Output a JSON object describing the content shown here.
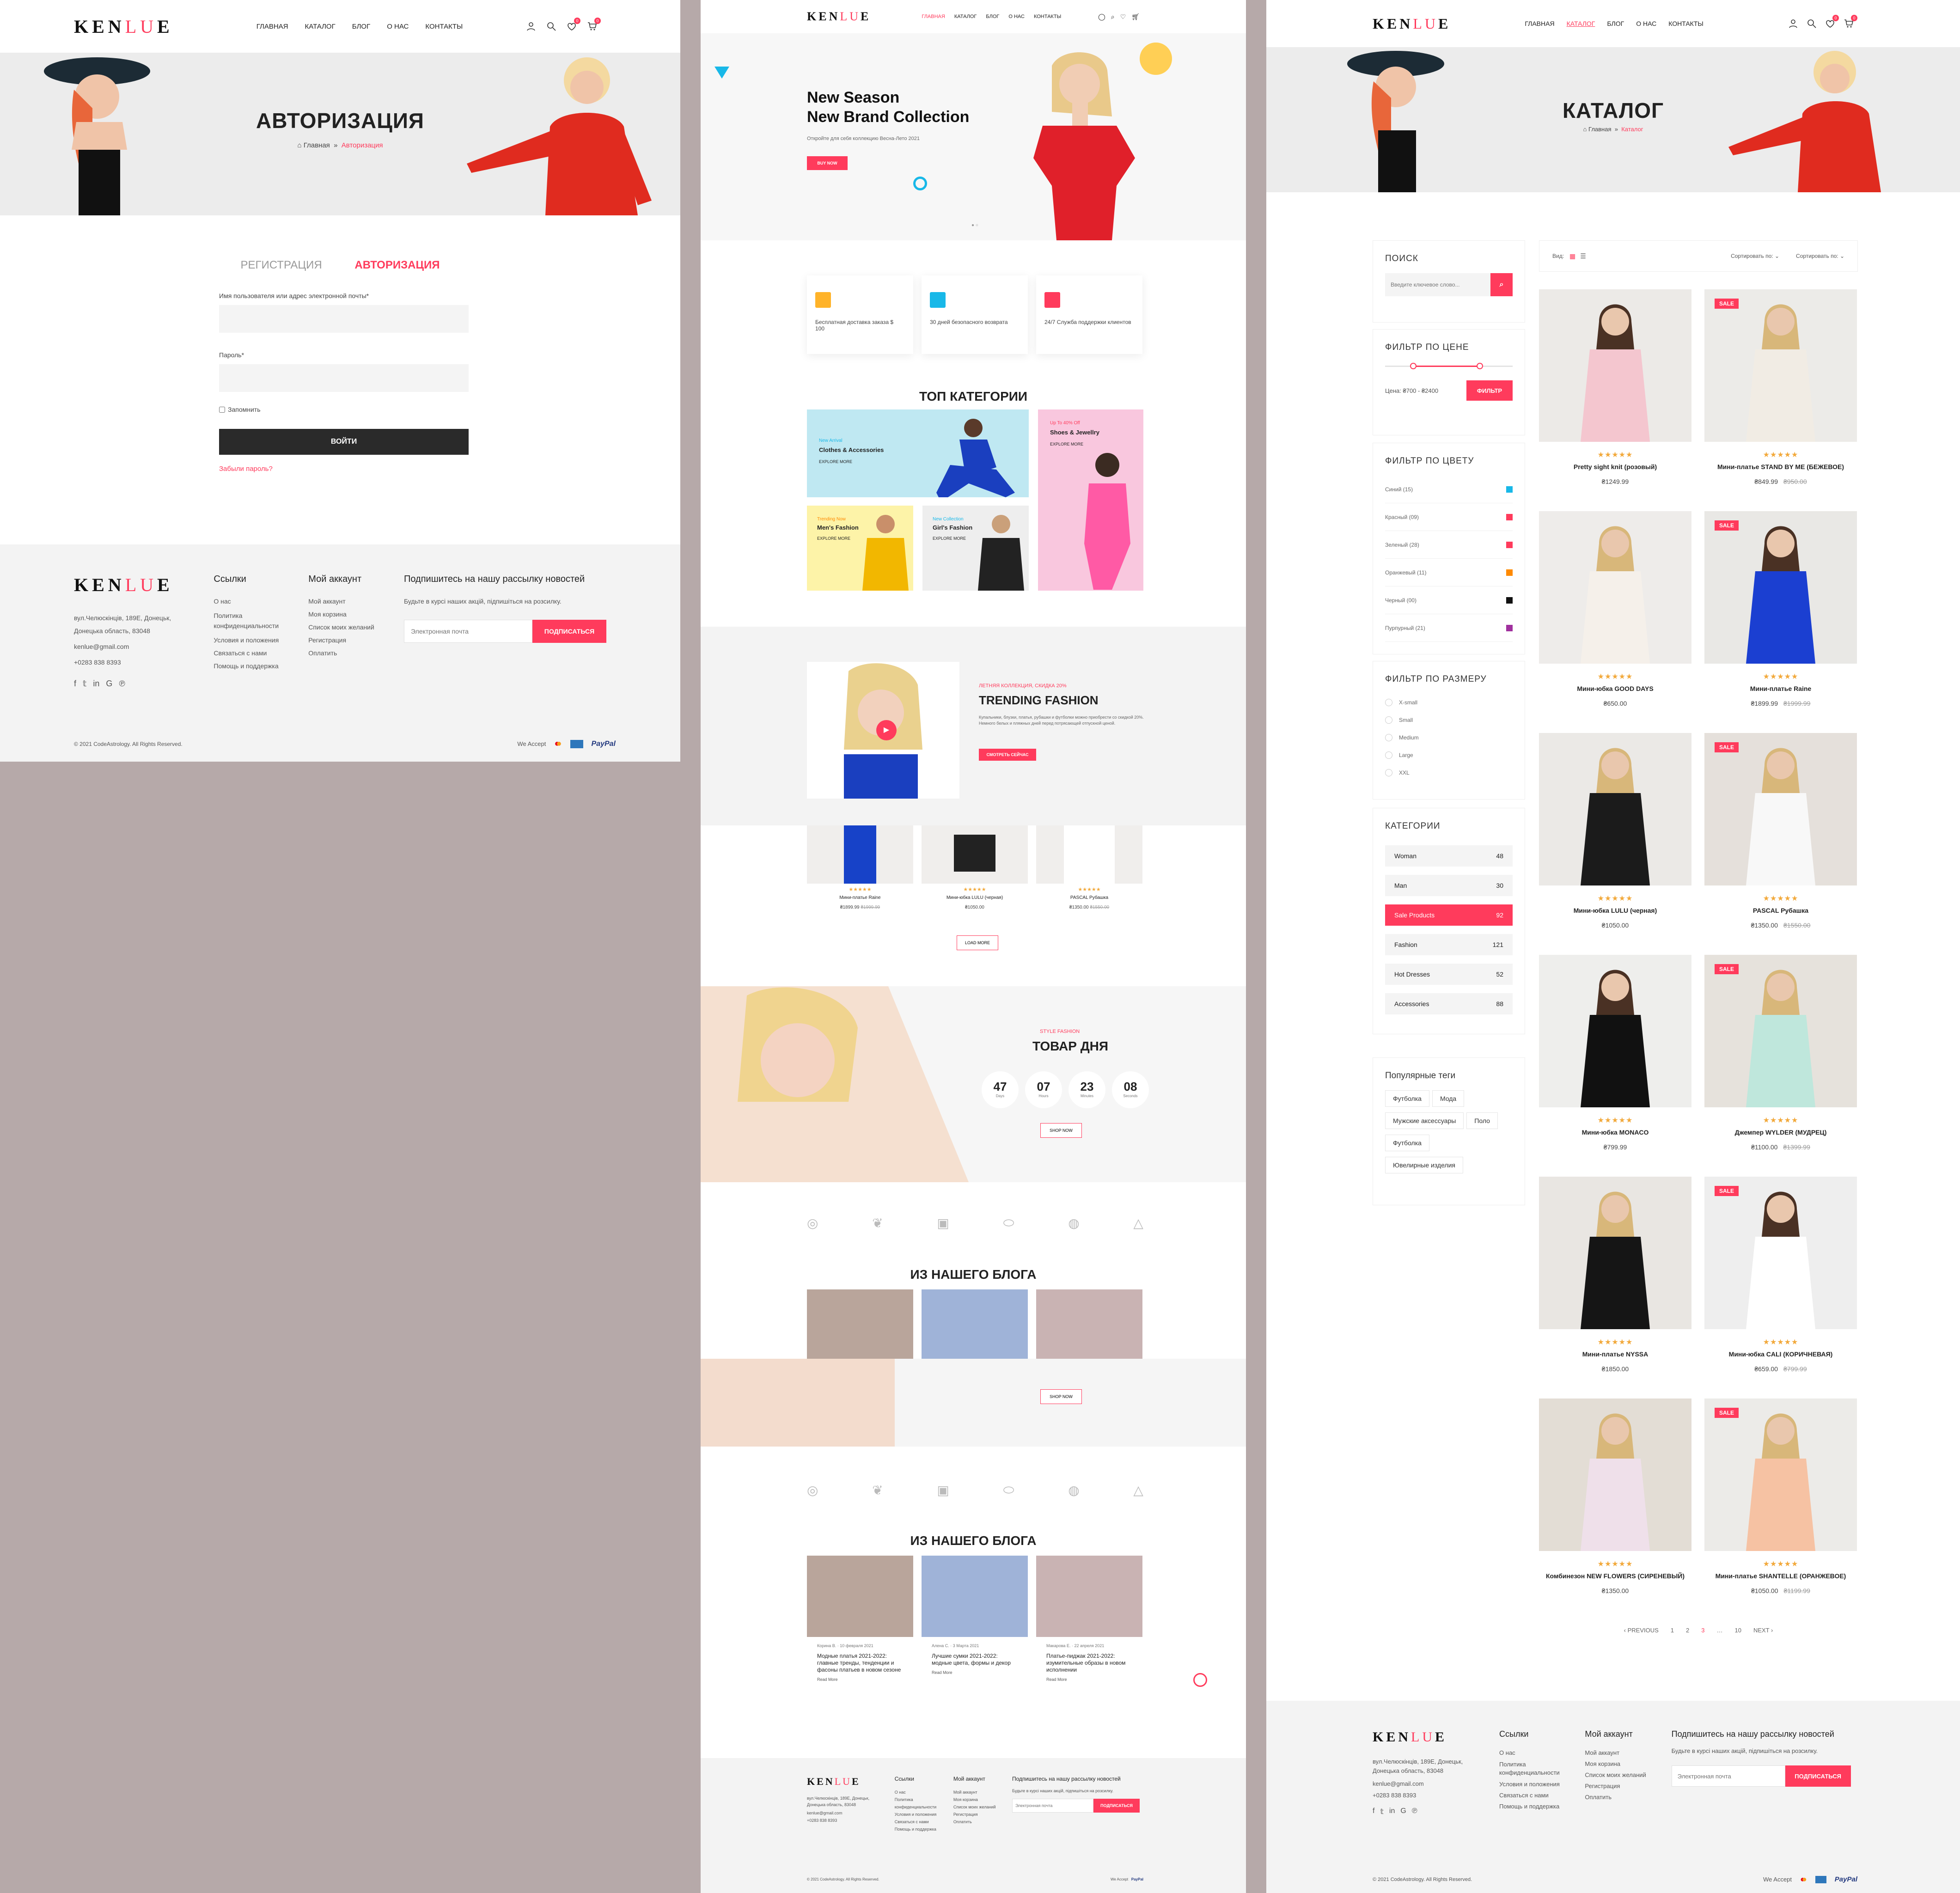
{
  "brand": {
    "logo_a": "KEN",
    "logo_b": "LU",
    "logo_c": "E"
  },
  "nav": {
    "home": "ГЛАВНАЯ",
    "catalog": "КАТАЛОГ",
    "blog": "БЛОГ",
    "about": "О НАС",
    "contacts": "КОНТАКТЫ"
  },
  "icons": {
    "user": "user-icon",
    "search": "search-icon",
    "wishlist": "heart-icon",
    "cart": "cart-icon"
  },
  "header_badges": {
    "wishlist": "0",
    "cart": "0"
  },
  "colors": {
    "accent": "#ff3b5c",
    "dark": "#222222",
    "stars": "#f2a93b"
  },
  "login_page": {
    "banner_title": "АВТОРИЗАЦИЯ",
    "crumb_home": "Главная",
    "crumb_current": "Авторизация",
    "tab_register": "РЕГИСТРАЦИЯ",
    "tab_login": "АВТОРИЗАЦИЯ",
    "username_label": "Имя пользователя или адрес электронной почты*",
    "password_label": "Пароль*",
    "remember_label": "Запомнить",
    "login_button": "ВОЙТИ",
    "forgot_link": "Забыли пароль?"
  },
  "footer": {
    "address": "вул.Челюскінців, 189Е, Донецьк, Донецька область, 83048",
    "email": "kenlue@gmail.com",
    "phone": "+0283 838 8393",
    "links_title": "Ссылки",
    "links": [
      "О нас",
      "Политика конфиденциальности",
      "Условия и положения",
      "Связаться с нами",
      "Помощь и поддержка"
    ],
    "account_title": "Мой аккаунт",
    "account_links": [
      "Мой аккаунт",
      "Моя корзина",
      "Список моих желаний",
      "Регистрация",
      "Оплатить"
    ],
    "newsletter_title": "Подпишитесь на нашу рассылку новостей",
    "newsletter_text": "Будьте в курсі наших акцій, підпишіться на розсилку.",
    "email_placeholder": "Электронная почта",
    "subscribe_button": "ПОДПИСАТЬСЯ",
    "copyright": "© 2021 CodeAstrology. All Rights Reserved.",
    "we_accept": "We Accept",
    "paypal": "PayPal"
  },
  "home_page": {
    "hero_line1": "New Season",
    "hero_line2": "New Brand Collection",
    "hero_sub": "Откройте для себя коллекцию Весна-Лето 2021",
    "hero_button": "BUY NOW",
    "features": [
      "Бесплатная доставка заказа $ 100",
      "30 дней безопасного возврата",
      "24/7 Служба поддержки клиентов"
    ],
    "top_categories_title": "ТОП КАТЕГОРИИ",
    "cat1_kicker": "New Arrival",
    "cat1_title": "Clothes & Accessories",
    "cat1_link": "EXPLORE MORE",
    "cat2_kicker": "Up To 40% Off",
    "cat2_title": "Shoes & Jewellry",
    "cat2_link": "EXPLORE MORE",
    "cat3_kicker": "Trending Now",
    "cat3_title": "Men's Fashion",
    "cat3_link": "EXPLORE MORE",
    "cat4_kicker": "New Collection",
    "cat4_title": "Girl's Fashion",
    "cat4_link": "EXPLORE MORE",
    "trend_kicker": "ЛЕТНЯЯ КОЛЛЕКЦИЯ, СКИДКА 20%",
    "trend_title": "TRENDING FASHION",
    "trend_text": "Купальники, блузки, платья, рубашки и футболки можно приобрести со скидкой 20%. Немного белых и пляжных дней перед потрясающей отпускной ценой.",
    "trend_button": "СМОТРЕТЬ СЕЙЧАС",
    "mini_products": [
      {
        "name": "Мини-платье Raine",
        "price": "₴1899.99",
        "old": "₴1999.99"
      },
      {
        "name": "Мини-юбка LULU (черная)",
        "price": "₴1050.00",
        "old": ""
      },
      {
        "name": "PASCAL Рубашка",
        "price": "₴1350.00",
        "old": "₴1550.00"
      }
    ],
    "load_more": "LOAD MORE",
    "deal_kicker": "STYLE FASHION",
    "deal_title": "ТОВАР ДНЯ",
    "countdown": [
      {
        "v": "47",
        "l": "Days"
      },
      {
        "v": "07",
        "l": "Hours"
      },
      {
        "v": "23",
        "l": "Minutes"
      },
      {
        "v": "08",
        "l": "Seconds"
      }
    ],
    "deal_button": "SHOP NOW",
    "blog_title": "ИЗ НАШЕГО БЛОГА",
    "posts": [
      {
        "author": "Корина В.",
        "date": "10 февраля 2021",
        "title": "Модные платья 2021-2022: главные тренды, тенденции и фасоны платьев в новом сезоне",
        "more": "Read More"
      },
      {
        "author": "Алена С.",
        "date": "3 Марта 2021",
        "title": "Лучшие сумки 2021-2022: модные цвета, формы и декор",
        "more": "Read More"
      },
      {
        "author": "Макарова Е.",
        "date": "22 апреля 2021",
        "title": "Платье-пиджак 2021-2022: изумительные образы в новом исполнении",
        "more": "Read More"
      }
    ]
  },
  "catalog_page": {
    "banner_title": "КАТАЛОГ",
    "crumb_home": "Главная",
    "crumb_current": "Каталог",
    "search_title": "ПОИСК",
    "search_placeholder": "Введите ключевое слово...",
    "price_title": "ФИЛЬТР ПО ЦЕНЕ",
    "price_range": "Цена: ₴700 - ₴2400",
    "filter_button": "ФИЛЬТР",
    "color_title": "ФИЛЬТР ПО ЦВЕТУ",
    "colors": [
      {
        "name": "Синий (15)",
        "hex": "#18b8e8"
      },
      {
        "name": "Красный (09)",
        "hex": "#ff3b5c"
      },
      {
        "name": "Зеленый (28)",
        "hex": "#ff3b5c"
      },
      {
        "name": "Оранжевый (11)",
        "hex": "#ff8a00"
      },
      {
        "name": "Черный (00)",
        "hex": "#111111"
      },
      {
        "name": "Пурпурный (21)",
        "hex": "#a0309e"
      }
    ],
    "size_title": "ФИЛЬТР ПО РАЗМЕРУ",
    "sizes": [
      "X-small",
      "Small",
      "Medium",
      "Large",
      "XXL"
    ],
    "cat_title": "КАТЕГОРИИ",
    "categories": [
      {
        "name": "Woman",
        "count": "48"
      },
      {
        "name": "Man",
        "count": "30"
      },
      {
        "name": "Sale Products",
        "count": "92"
      },
      {
        "name": "Fashion",
        "count": "121"
      },
      {
        "name": "Hot Dresses",
        "count": "52"
      },
      {
        "name": "Accessories",
        "count": "88"
      }
    ],
    "tags_title": "Популярные теги",
    "tags": [
      "Футболка",
      "Мода",
      "Мужские аксессуары",
      "Поло",
      "Футболка",
      "Ювелирные изделия"
    ],
    "view_label": "Вид:",
    "sort1": "Сортировать по:",
    "sort2": "Сортировать по:",
    "sale_badge": "SALE",
    "stars_text": "★★★★★",
    "products": [
      {
        "name": "Pretty sight knit (розовый)",
        "price": "₴1249.99",
        "old": ""
      },
      {
        "name": "Мини-платье STAND BY ME (БЕЖЕВОЕ)",
        "price": "₴849.99",
        "old": "₴950.00"
      },
      {
        "name": "Мини-юбка GOOD DAYS",
        "price": "₴650.00",
        "old": ""
      },
      {
        "name": "Мини-платье Raine",
        "price": "₴1899.99",
        "old": "₴1999.99"
      },
      {
        "name": "Мини-юбка LULU (черная)",
        "price": "₴1050.00",
        "old": ""
      },
      {
        "name": "PASCAL Рубашка",
        "price": "₴1350.00",
        "old": "₴1550.00"
      },
      {
        "name": "Мини-юбка MONACO",
        "price": "₴799.99",
        "old": ""
      },
      {
        "name": "Джемпер WYLDER (МУДРЕЦ)",
        "price": "₴1100.00",
        "old": "₴1399.99"
      },
      {
        "name": "Мини-платье NYSSA",
        "price": "₴1850.00",
        "old": ""
      },
      {
        "name": "Мини-юбка CALI (КОРИЧНЕВАЯ)",
        "price": "₴659.00",
        "old": "₴799.99"
      },
      {
        "name": "Комбинезон NEW FLOWERS (СИРЕНЕВЫЙ)",
        "price": "₴1350.00",
        "old": ""
      },
      {
        "name": "Мини-платье SHANTELLE (ОРАНЖЕВОЕ)",
        "price": "₴1050.00",
        "old": "₴1199.99"
      }
    ],
    "pagination": [
      "‹ PREVIOUS",
      "1",
      "2",
      "3",
      "…",
      "10",
      "NEXT ›"
    ]
  }
}
